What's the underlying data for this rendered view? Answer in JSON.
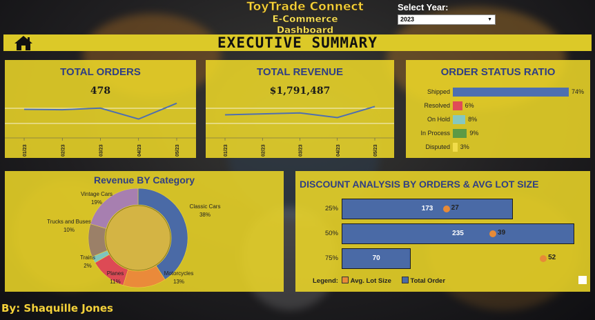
{
  "header": {
    "title_line1": "ToyTrade Connect",
    "title_line2": "E-Commerce Dashboard",
    "year_label": "Select Year:",
    "year_value": "2023"
  },
  "banner": {
    "title": "EXECUTIVE SUMMARY",
    "home_icon": "home-icon"
  },
  "cards": {
    "orders": {
      "title": "TOTAL ORDERS",
      "value": "478",
      "chart_data": {
        "type": "line",
        "x": [
          "01/23",
          "02/23",
          "03/23",
          "04/23",
          "05/23"
        ],
        "values": [
          97,
          96,
          100,
          73,
          112
        ],
        "ylim": [
          40,
          120
        ],
        "title": ""
      }
    },
    "revenue": {
      "title": "TOTAL REVENUE",
      "value": "$1,791,487",
      "chart_data": {
        "type": "line",
        "x": [
          "01/23",
          "02/23",
          "03/23",
          "04/23",
          "05/23"
        ],
        "values": [
          340000,
          350000,
          360000,
          310000,
          430000
        ],
        "ylim": [
          150000,
          500000
        ],
        "title": ""
      }
    },
    "status": {
      "title": "ORDER STATUS RATIO",
      "chart_data": {
        "type": "bar",
        "orientation": "horizontal",
        "categories": [
          "Shipped",
          "Resolved",
          "On Hold",
          "In Process",
          "Disputed"
        ],
        "values": [
          74,
          6,
          8,
          9,
          3
        ],
        "labels": [
          "74%",
          "6%",
          "8%",
          "9%",
          "3%"
        ],
        "colors": [
          "#4e6fb0",
          "#e04b57",
          "#86c8c0",
          "#5c9a45",
          "#f2dd4a"
        ],
        "xlim": [
          0,
          100
        ]
      }
    },
    "category": {
      "title": "Revenue BY Category",
      "chart_data": {
        "type": "pie",
        "donut": true,
        "categories": [
          "Classic Cars",
          "Motorcycles",
          "Planes",
          "Trains",
          "Trucks and Buses",
          "Vintage Cars"
        ],
        "values": [
          38,
          13,
          11,
          2,
          10,
          19
        ],
        "labels": [
          "38%",
          "13%",
          "11%",
          "2%",
          "10%",
          "19%"
        ],
        "colors": [
          "#4a6aa6",
          "#ea8a3a",
          "#dd4a55",
          "#7fc4bd",
          "#9b8068",
          "#a77fb0"
        ]
      }
    },
    "discount": {
      "title": "DISCOUNT ANALYSIS BY ORDERS & AVG LOT SIZE",
      "chart_data": {
        "type": "bar",
        "orientation": "horizontal",
        "categories": [
          "25%",
          "50%",
          "75%"
        ],
        "series": [
          {
            "name": "Total Order",
            "values": [
              173,
              235,
              70
            ]
          },
          {
            "name": "Avg. Lot Size",
            "values": [
              27,
              39,
              52
            ]
          }
        ],
        "xlim": [
          0,
          235
        ]
      },
      "legend": {
        "label": "Legend:",
        "items": [
          {
            "name": "Avg. Lot Size",
            "color": "#e78a37"
          },
          {
            "name": "Total Order",
            "color": "#4a6aa6"
          }
        ]
      }
    }
  },
  "author": "By: Shaquille Jones"
}
